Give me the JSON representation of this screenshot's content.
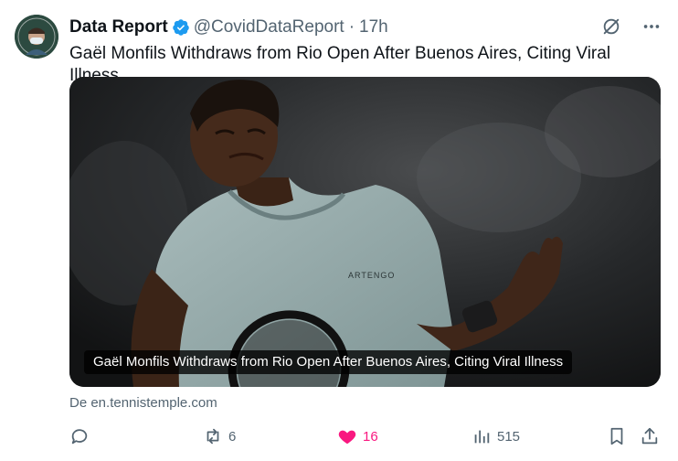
{
  "tweet": {
    "author": {
      "display_name": "Data Report",
      "handle": "@CovidDataReport",
      "time": "17h",
      "avatar_text": "DATA REPORT"
    },
    "text": "Gaël Monfils Withdraws from Rio Open After Buenos Aires, Citing Viral Illness.",
    "media": {
      "caption": "Gaël Monfils Withdraws from Rio Open After Buenos Aires, Citing Viral Illness",
      "shirt_brand": "ARTENGO"
    },
    "source": "De en.tennistemple.com",
    "actions": {
      "reply_count": "",
      "retweet_count": "6",
      "like_count": "16",
      "views_count": "515"
    }
  },
  "colors": {
    "like": "#f91880",
    "verified": "#1d9bf0",
    "muted": "#536471"
  }
}
